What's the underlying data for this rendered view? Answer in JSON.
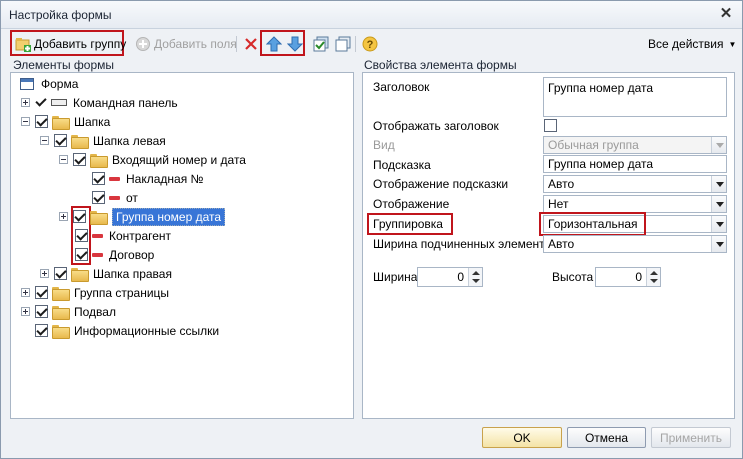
{
  "window": {
    "title": "Настройка формы"
  },
  "toolbar": {
    "add_group": "Добавить группу",
    "add_fields": "Добавить поля",
    "all_actions": "Все действия"
  },
  "left_pane": {
    "label": "Элементы формы",
    "items": [
      {
        "label": "Форма"
      },
      {
        "label": "Командная панель"
      },
      {
        "label": "Шапка"
      },
      {
        "label": "Шапка левая"
      },
      {
        "label": "Входящий номер и дата"
      },
      {
        "label": "Накладная №"
      },
      {
        "label": "от"
      },
      {
        "label": "Группа номер дата"
      },
      {
        "label": "Контрагент"
      },
      {
        "label": "Договор"
      },
      {
        "label": "Шапка правая"
      },
      {
        "label": "Группа страницы"
      },
      {
        "label": "Подвал"
      },
      {
        "label": "Информационные ссылки"
      }
    ]
  },
  "right_pane": {
    "label": "Свойства элемента формы",
    "props": {
      "title_label": "Заголовок",
      "title_value": "Группа номер дата",
      "show_title_label": "Отображать заголовок",
      "kind_label": "Вид",
      "kind_value": "Обычная группа",
      "hint_label": "Подсказка",
      "hint_value": "Группа номер дата",
      "hint_display_label": "Отображение подсказки",
      "hint_display_value": "Авто",
      "display_label": "Отображение",
      "display_value": "Нет",
      "grouping_label": "Группировка",
      "grouping_value": "Горизонтальная",
      "child_width_label": "Ширина подчиненных элементов",
      "child_width_value": "Авто",
      "width_label": "Ширина",
      "width_value": "0",
      "height_label": "Высота",
      "height_value": "0"
    }
  },
  "buttons": {
    "ok": "OK",
    "cancel": "Отмена",
    "apply": "Применить"
  }
}
